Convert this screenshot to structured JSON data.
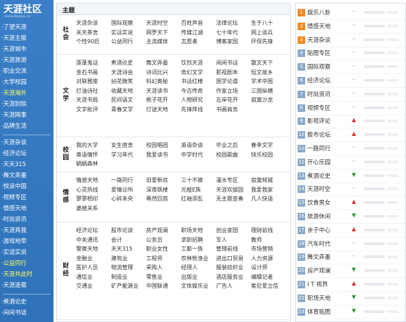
{
  "logo": {
    "title": "天涯社区",
    "subtitle": "www.tianya.cn"
  },
  "sidebar": {
    "group1": [
      {
        "label": "·了望天涯",
        "highlight": false
      },
      {
        "label": "·天涯主版",
        "highlight": false
      },
      {
        "label": "·天涯城市",
        "highlight": false
      },
      {
        "label": "·天涯旅游",
        "highlight": false
      },
      {
        "label": "·职业交流",
        "highlight": false
      },
      {
        "label": "·大学校园",
        "highlight": false
      },
      {
        "label": "·天涯海外",
        "highlight": true
      },
      {
        "label": "·天涯别院",
        "highlight": false
      },
      {
        "label": "·天涯网事",
        "highlight": false
      },
      {
        "label": "·品牌生活",
        "highlight": false
      }
    ],
    "group2": [
      {
        "label": "·天涯杂谈",
        "highlight": false
      },
      {
        "label": "·经济论坛",
        "highlight": false
      },
      {
        "label": "·天天315",
        "highlight": false
      },
      {
        "label": "·舞文弄墨",
        "highlight": false
      },
      {
        "label": "·悦读中国",
        "highlight": false
      },
      {
        "label": "·视频专区",
        "highlight": false
      },
      {
        "label": "·情感天地",
        "highlight": false
      },
      {
        "label": "·时尚资讯",
        "highlight": false
      },
      {
        "label": "·天涯真我",
        "highlight": false
      },
      {
        "label": "·游戏地带",
        "highlight": false
      },
      {
        "label": "·实话实说",
        "highlight": false
      },
      {
        "label": "·公益同行",
        "highlight": true
      },
      {
        "label": "·天涯共此时",
        "highlight": true
      },
      {
        "label": "·天涯连载",
        "highlight": false
      }
    ],
    "group3": [
      {
        "label": "·煮酒论史",
        "highlight": false
      },
      {
        "label": "·闲闲书话",
        "highlight": false
      }
    ]
  },
  "main": {
    "title": "主题",
    "sections": [
      {
        "category": "社会",
        "items": [
          "天涯杂谈",
          "国际观察",
          "天涯时空",
          "百姓声音",
          "法律论坛",
          "生于八十",
          "关天茶舍",
          "实话实说",
          "网罗天下",
          "传媒江湖",
          "七十年代",
          "网上谈兵",
          "个性90后",
          "公益同行",
          "主流媒体",
          "志愿者",
          "博客家园",
          "环保先锋"
        ]
      },
      {
        "category": "文学",
        "items": [
          "莲蓬鬼话",
          "煮酒论史",
          "舞文弄墨",
          "饮烈天涯",
          "闲闲书话",
          "散文天下",
          "金石书画",
          "天涯诗会",
          "诗词比兴",
          "奇幻文学",
          "影视剧本",
          "短文故乡",
          "对联雅座",
          "拈花微笑",
          "科幻奥秘",
          "书话红楼",
          "国学论道",
          "学术中国",
          "打油诗社",
          "收藏天地",
          "天涯读书",
          "今古传奇",
          "作家立场",
          "三国纵横",
          "天涯书局",
          "民间语文",
          "栀子花开",
          "人物研究",
          "左岸花开",
          "寂寞沙龙",
          "文学批评",
          "青春文学",
          "灯谜天地",
          "先锋阵线",
          "书画商务"
        ]
      },
      {
        "category": "校园",
        "items": [
          "我的大学",
          "女生宿舍",
          "校园唱园",
          "英语杂谈",
          "毕业之后",
          "春季文学",
          "寄语情怀",
          "学习年代",
          "我爱读书",
          "中学时代",
          "校园歌曲",
          "快乐校园",
          "蜗蜗森林"
        ]
      },
      {
        "category": "情感",
        "items": [
          "情感天地",
          "一路同行",
          "旧爱新欢",
          "三十不嫁",
          "灌水专区",
          "寂寞倾城",
          "心灵热线",
          "爱情诊所",
          "深夜跳楼",
          "光棍E族",
          "天涯欢娱园",
          "我爱我家",
          "寥寥相印",
          "心碎未央",
          "蓦然回首",
          "红袖添乱",
          "无主题变奏",
          "凡人快语",
          "婆媳关系"
        ]
      },
      {
        "category": "财经",
        "items": [
          "经济论坛",
          "股市论谈",
          "房产观澜",
          "职场天地",
          "创业家园",
          "理财前线",
          "中关通讯",
          "会计",
          "公务员",
          "求职招聘",
          "军人",
          "教师",
          "警察天地",
          "天天315",
          "职业女性",
          "工薪一族",
          "管理前线",
          "市场营销",
          "金融业",
          "建筑业",
          "工程师",
          "农林牧渔业",
          "进出口贸易",
          "人力资源",
          "医护人员",
          "物流管理",
          "采购人",
          "经理人",
          "服装纺织业",
          "设计师",
          "通信业",
          "制造业",
          "零售业",
          "出版业",
          "酒店服务业",
          "编辑记者",
          "交通业",
          "矿产能源业",
          "中国联通",
          "文体娱乐业",
          "广告人",
          "索尼爱立信"
        ]
      }
    ]
  },
  "ranking": [
    {
      "no": "1",
      "name": "娱乐八卦",
      "trend": "dash"
    },
    {
      "no": "2",
      "name": "情感天地",
      "trend": "dash"
    },
    {
      "no": "3",
      "name": "天涯杂谈",
      "trend": "dash"
    },
    {
      "no": "4",
      "name": "贴图专区",
      "trend": "dash"
    },
    {
      "no": "5",
      "name": "国际观察",
      "trend": "dash"
    },
    {
      "no": "6",
      "name": "经济论坛",
      "trend": "dash"
    },
    {
      "no": "7",
      "name": "时尚资讯",
      "trend": "dash"
    },
    {
      "no": "8",
      "name": "视频专区",
      "trend": "dash"
    },
    {
      "no": "9",
      "name": "影视评论",
      "trend": "up"
    },
    {
      "no": "10",
      "name": "股市论坛",
      "trend": "up"
    },
    {
      "no": "11",
      "name": "一路同行",
      "trend": "dash"
    },
    {
      "no": "12",
      "name": "开心乐园",
      "trend": "dash"
    },
    {
      "no": "13",
      "name": "煮酒论史",
      "trend": "down"
    },
    {
      "no": "14",
      "name": "天涯时空",
      "trend": "dash"
    },
    {
      "no": "15",
      "name": "饮食男女",
      "trend": "up"
    },
    {
      "no": "16",
      "name": "旅游休闲",
      "trend": "down"
    },
    {
      "no": "17",
      "name": "亲子中心",
      "trend": "up"
    },
    {
      "no": "18",
      "name": "汽车时代",
      "trend": "dash"
    },
    {
      "no": "19",
      "name": "舞文弄墨",
      "trend": "dash"
    },
    {
      "no": "20",
      "name": "房产观澜",
      "trend": "down"
    },
    {
      "no": "21",
      "name": "I T 视界",
      "trend": "up"
    },
    {
      "no": "22",
      "name": "职场天地",
      "trend": "down"
    },
    {
      "no": "23",
      "name": "体育贴图",
      "trend": "down"
    }
  ],
  "colors": {
    "sidebar": "#3a7fc7",
    "top_rank": "#f08a24",
    "rank": "#8aa9c9",
    "up": "#d9302c",
    "down": "#2f9a3a"
  }
}
